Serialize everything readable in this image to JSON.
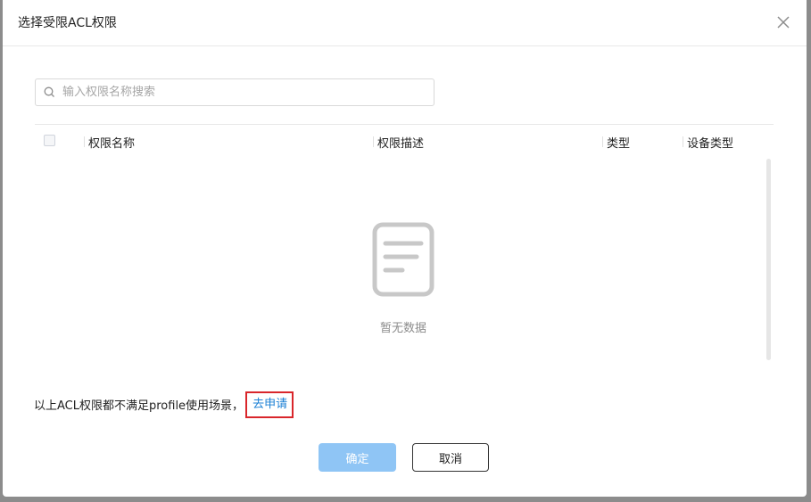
{
  "dialog": {
    "title": "选择受限ACL权限",
    "close_icon": "close-icon"
  },
  "search": {
    "placeholder": "输入权限名称搜索",
    "value": "",
    "icon": "search-icon"
  },
  "table": {
    "columns": [
      "权限名称",
      "权限描述",
      "类型",
      "设备类型"
    ],
    "rows": [],
    "empty_icon": "document-icon",
    "empty_text": "暂无数据"
  },
  "footer_note": {
    "text": "以上ACL权限都不满足profile使用场景，",
    "link_label": "去申请"
  },
  "buttons": {
    "confirm_label": "确定",
    "cancel_label": "取消"
  },
  "colors": {
    "primary_disabled": "#8fc5f5",
    "link": "#1a7fd4",
    "highlight_border": "#d9262b"
  }
}
